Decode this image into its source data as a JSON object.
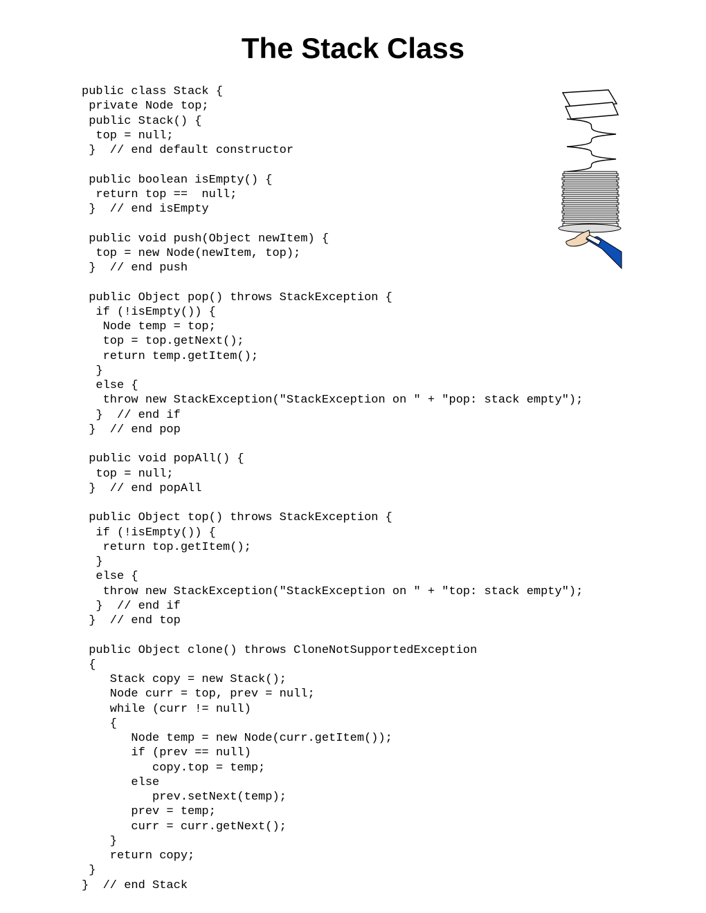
{
  "title": "The Stack Class",
  "code": "public class Stack {\n private Node top;\n public Stack() {\n  top = null;\n }  // end default constructor\n\n public boolean isEmpty() {\n  return top ==  null;\n }  // end isEmpty\n\n public void push(Object newItem) {\n  top = new Node(newItem, top);\n }  // end push\n\n public Object pop() throws StackException {\n  if (!isEmpty()) {\n   Node temp = top;\n   top = top.getNext();\n   return temp.getItem();\n  }\n  else {\n   throw new StackException(\"StackException on \" + \"pop: stack empty\");\n  }  // end if\n }  // end pop\n\n public void popAll() {\n  top = null;\n }  // end popAll\n\n public Object top() throws StackException {\n  if (!isEmpty()) {\n   return top.getItem();\n  }\n  else {\n   throw new StackException(\"StackException on \" + \"top: stack empty\");\n  }  // end if\n }  // end top\n\n public Object clone() throws CloneNotSupportedException\n {\n    Stack copy = new Stack();\n    Node curr = top, prev = null;\n    while (curr != null)\n    {\n       Node temp = new Node(curr.getItem());\n       if (prev == null)\n          copy.top = temp;\n       else\n          prev.setNext(temp);\n       prev = temp;\n       curr = curr.getNext();\n    }\n    return copy;\n }\n}  // end Stack"
}
